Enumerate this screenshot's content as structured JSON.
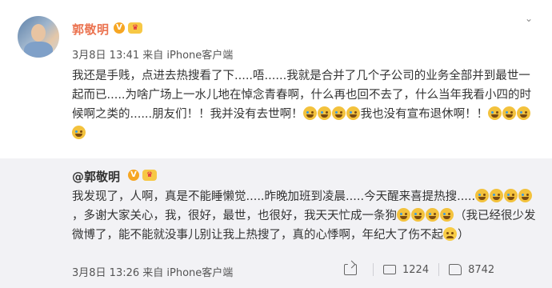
{
  "post": {
    "author": "郭敬明",
    "verified_mark": "V",
    "crown_mark": "♛",
    "timestamp": "3月8日 13:41 来自 iPhone客户端",
    "text_1": "我还是手贱，点进去热搜看了下.....唔......我就是合并了几个子公司的业务全部并到最世一起而已.....为啥广场上一水儿地在悼念青春啊，什么再也回不去了，什么当年我看小四的时候啊之类的......朋友们！！我并没有去世啊！",
    "text_2": "我也没有宣布退休啊！！"
  },
  "repost": {
    "author": "@郭敬明",
    "verified_mark": "V",
    "crown_mark": "♛",
    "text_1": "我发现了，人啊，真是不能睡懒觉.....昨晚加班到凌晨.....今天醒来喜提热搜.....",
    "text_2": "，多谢大家关心，我，很好，最世，也很好，我天天忙成一条狗",
    "text_3": "（我已经很少发微博了，能不能就没事儿别让我上热搜了，真的心悸啊，年纪大了伤不起",
    "text_4": "）",
    "timestamp": "3月8日 13:26 来自 iPhone客户端",
    "share_count": "1224",
    "like_count": "8742"
  },
  "ui": {
    "chevron": "⌄"
  }
}
